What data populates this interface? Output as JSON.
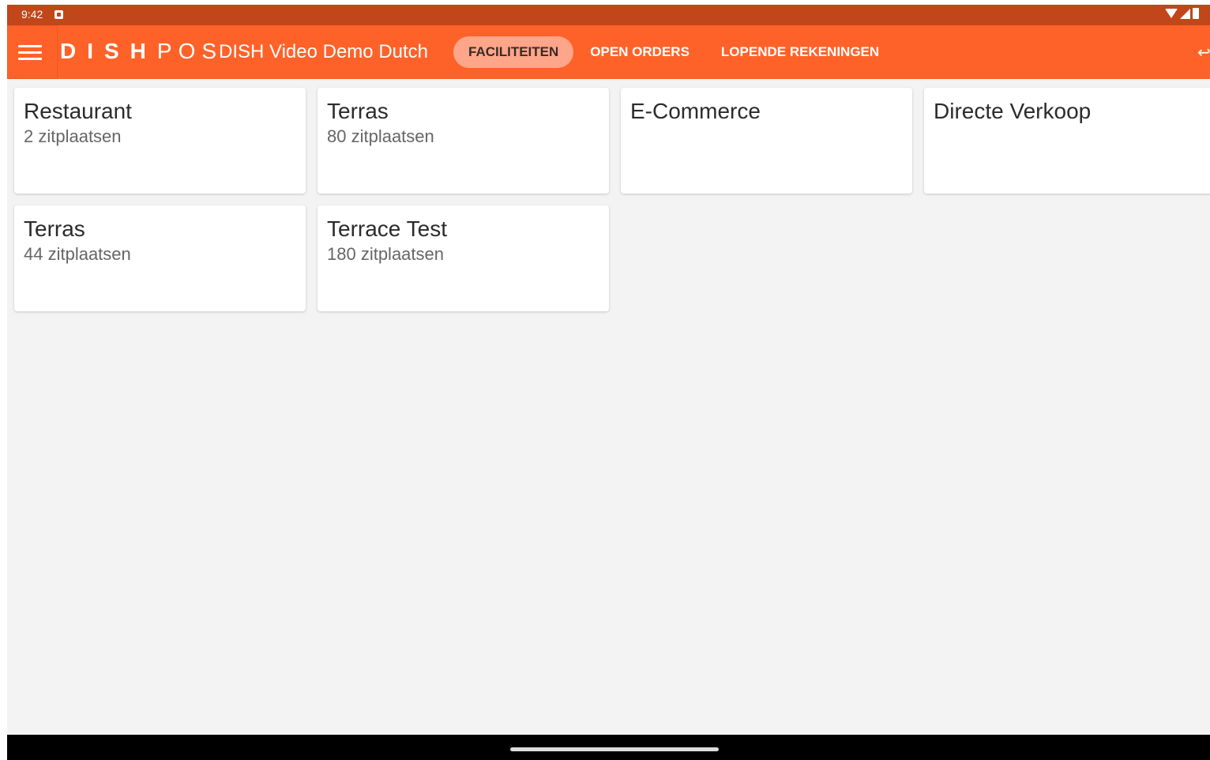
{
  "status_bar": {
    "time": "9:42",
    "icons": [
      "notification-icon",
      "wifi-icon",
      "signal-icon",
      "battery-icon"
    ]
  },
  "app_bar": {
    "brand_bold": "DISH",
    "brand_light": "POS",
    "venue": "DISH Video Demo Dutch",
    "tabs": [
      {
        "label": "FACILITEITEN",
        "active": true
      },
      {
        "label": "OPEN ORDERS",
        "active": false
      },
      {
        "label": "LOPENDE REKENINGEN",
        "active": false
      }
    ],
    "icons": [
      "menu-icon",
      "back-icon"
    ]
  },
  "facilities": [
    {
      "title": "Restaurant",
      "subtitle": "2 zitplaatsen"
    },
    {
      "title": "Terras",
      "subtitle": "80 zitplaatsen"
    },
    {
      "title": "E-Commerce",
      "subtitle": ""
    },
    {
      "title": "Directe Verkoop",
      "subtitle": ""
    },
    {
      "title": "Terras",
      "subtitle": "44 zitplaatsen"
    },
    {
      "title": "Terrace Test",
      "subtitle": "180 zitplaatsen"
    }
  ],
  "colors": {
    "status_bar": "#c1461a",
    "app_bar": "#ff6228",
    "active_tab": "#ffa58a",
    "background": "#f3f3f3",
    "card": "#ffffff"
  }
}
